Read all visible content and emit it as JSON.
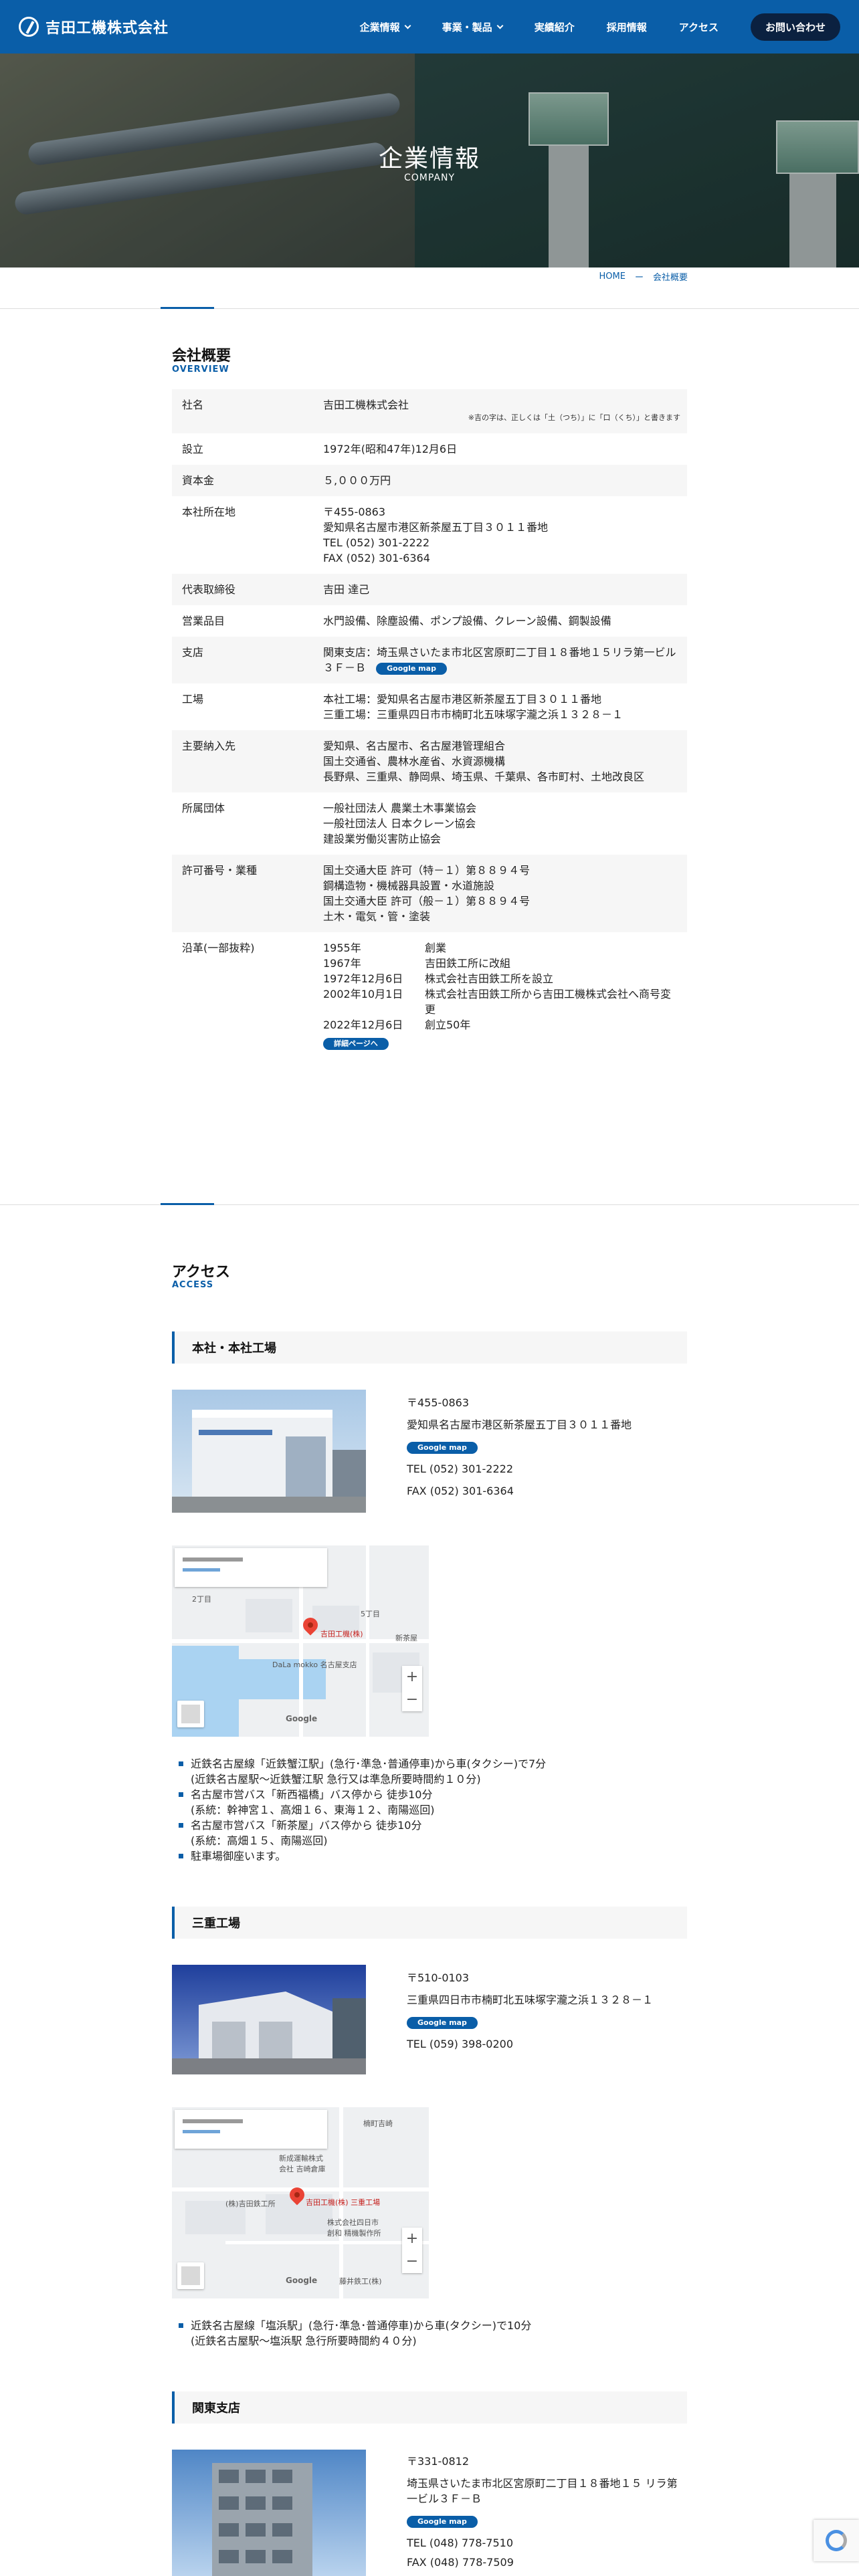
{
  "header": {
    "company_name": "吉田工機株式会社",
    "nav": [
      "企業情報",
      "事業・製品",
      "実績紹介",
      "採用情報",
      "アクセス"
    ],
    "contact_label": "お問い合わせ"
  },
  "hero": {
    "title": "企業情報",
    "subtitle": "COMPANY"
  },
  "breadcrumb": {
    "home": "HOME",
    "separator": "ー",
    "current": "会社概要"
  },
  "overview": {
    "title": "会社概要",
    "title_en": "OVERVIEW",
    "name_label": "社名",
    "name_value": "吉田工機株式会社",
    "name_note": "※吉の字は、正しくは「土（つち）」に「口（くち）」と書きます",
    "founded_label": "設立",
    "founded_value": "1972年(昭和47年)12月6日",
    "capital_label": "資本金",
    "capital_value": "５,０００万円",
    "address_label": "本社所在地",
    "address_lines": [
      "〒455-0863",
      "愛知県名古屋市港区新茶屋五丁目３０１１番地",
      "TEL (052) 301-2222",
      "FAX (052) 301-6364"
    ],
    "ceo_label": "代表取締役",
    "ceo_value": "吉田 達己",
    "products_label": "営業品目",
    "products_value": "水門設備、除塵設備、ポンプ設備、クレーン設備、鋼製設備",
    "branch_label": "支店",
    "branch_value": "関東支店：埼玉県さいたま市北区宮原町二丁目１８番地１５リラ第一ビル３Ｆ－Ｂ",
    "gmap_label": "Google map",
    "factory_label": "工場",
    "factory_lines": [
      "本社工場：愛知県名古屋市港区新茶屋五丁目３０１１番地",
      "三重工場：三重県四日市市楠町北五味塚字瀧之浜１３２８－１"
    ],
    "clients_label": "主要納入先",
    "clients_lines": [
      "愛知県、名古屋市、名古屋港管理組合",
      "国土交通省、農林水産省、水資源機構",
      "長野県、三重県、静岡県、埼玉県、千葉県、各市町村、土地改良区"
    ],
    "groups_label": "所属団体",
    "groups_lines": [
      "一般社団法人 農業土木事業協会",
      "一般社団法人 日本クレーン協会",
      "建設業労働災害防止協会"
    ],
    "license_label": "許可番号・業種",
    "license_lines": [
      "国土交通大臣 許可（特－１）第８８９４号",
      "鋼構造物・機械器具設置・水道施設",
      "国土交通大臣 許可（般－１）第８８９４号",
      "土木・電気・管・塗装"
    ],
    "history_label": "沿革(一部抜粋)",
    "history": [
      {
        "year": "1955年",
        "event": "創業"
      },
      {
        "year": "1967年",
        "event": "吉田鉄工所に改組"
      },
      {
        "year": "1972年12月6日",
        "event": "株式会社吉田鉄工所を設立"
      },
      {
        "year": "2002年10月1日",
        "event": "株式会社吉田鉄工所から吉田工機株式会社へ商号変更"
      },
      {
        "year": "2022年12月6日",
        "event": "創立50年"
      }
    ],
    "detail_label": "詳細ページへ"
  },
  "access": {
    "title": "アクセス",
    "title_en": "ACCESS",
    "gmap_label": "Google map",
    "map_google": "Google",
    "hq": {
      "title": "本社・本社工場",
      "zip": "〒455-0863",
      "address": "愛知県名古屋市港区新茶屋五丁目３０１１番地",
      "tel": "TEL (052) 301-2222",
      "fax": "FAX (052) 301-6364",
      "map_pin_label": "吉田工機(株)",
      "map_place": "DaLa mokko 名古屋支店",
      "map_chome": "5丁目",
      "map_chome2": "2丁目",
      "map_area": "新茶屋",
      "bullets": [
        [
          "近鉄名古屋線「近鉄蟹江駅」(急行･準急･普通停車)から車(タクシー)で7分",
          "(近鉄名古屋駅～近鉄蟹江駅 急行又は準急所要時間約１０分)"
        ],
        [
          "名古屋市営バス「新西福橋」バス停から 徒歩10分",
          "(系統：幹神宮１、高畑１６、東海１２、南陽巡回)"
        ],
        [
          "名古屋市営バス「新茶屋」バス停から 徒歩10分",
          "(系統：高畑１５、南陽巡回)"
        ],
        [
          "駐車場御座います。"
        ]
      ]
    },
    "mie": {
      "title": "三重工場",
      "zip": "〒510-0103",
      "address": "三重県四日市市楠町北五味塚字瀧之浜１３２８－１",
      "tel": "TEL (059) 398-0200",
      "map_pin_label": "吉田工機(株) 三重工場",
      "map_place1": "新成運輸株式\n会社 吉崎倉庫",
      "map_place2": "(株)吉田鉄工所",
      "map_place3": "株式会社四日市\n創和 精機製作所",
      "map_place4": "藤井鉄工(株)",
      "map_town": "楠町吉崎",
      "bullets": [
        [
          "近鉄名古屋線「塩浜駅」(急行･準急･普通停車)から車(タクシー)で10分",
          "(近鉄名古屋駅～塩浜駅 急行所要時間約４０分)"
        ]
      ]
    },
    "kanto": {
      "title": "関東支店",
      "zip": "〒331-0812",
      "address": "埼玉県さいたま市北区宮原町二丁目１８番地１５ リラ第一ビル３Ｆ－Ｂ",
      "tel": "TEL (048) 778-7510",
      "fax": "FAX (048) 778-7509"
    }
  }
}
